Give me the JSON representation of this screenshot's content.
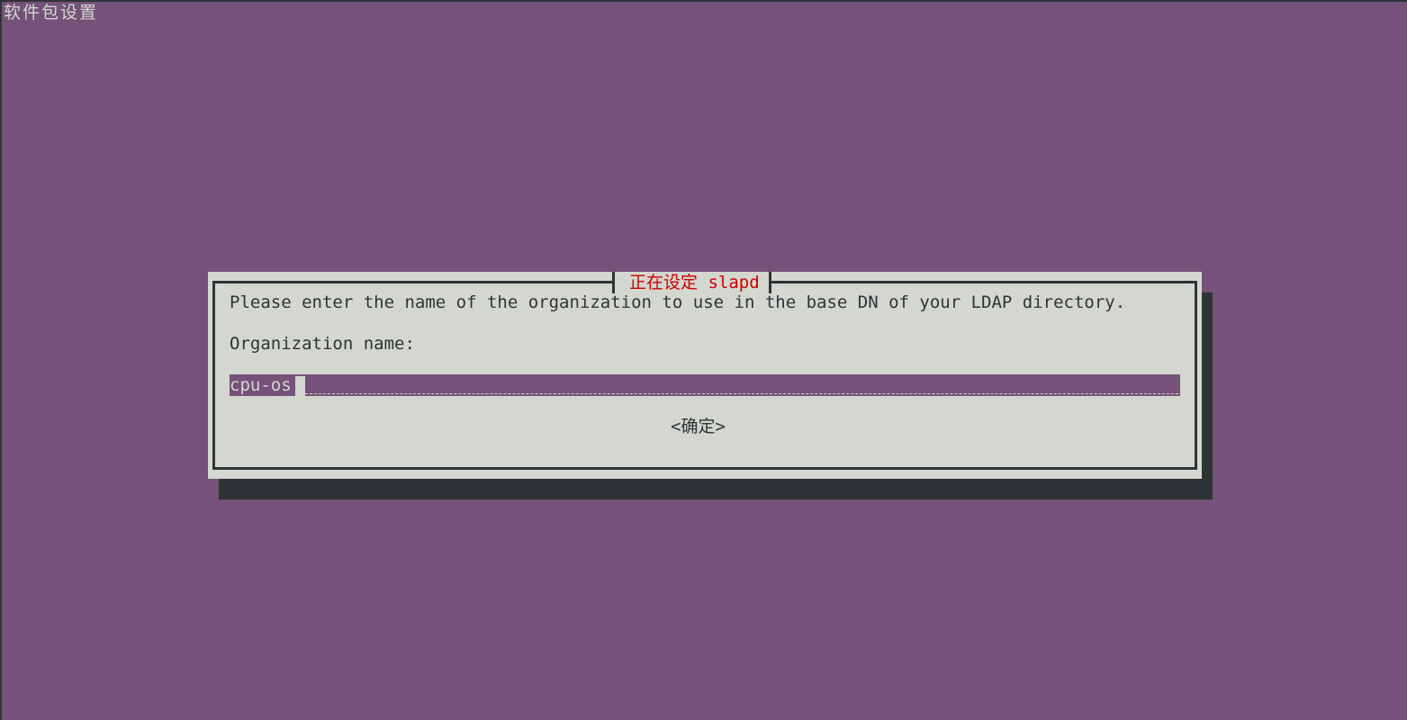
{
  "screen": {
    "title": "软件包设置"
  },
  "dialog": {
    "title": "正在设定 slapd",
    "prompt": "Please enter the name of the organization to use in the base DN of your LDAP directory.",
    "field_label": "Organization name:",
    "input_value": "cpu-os",
    "ok_button": "<确定>"
  },
  "colors": {
    "background": "#76517a",
    "dialog": "#d3d7cf",
    "title_text": "#cc0000",
    "shadow": "#2e3436"
  }
}
